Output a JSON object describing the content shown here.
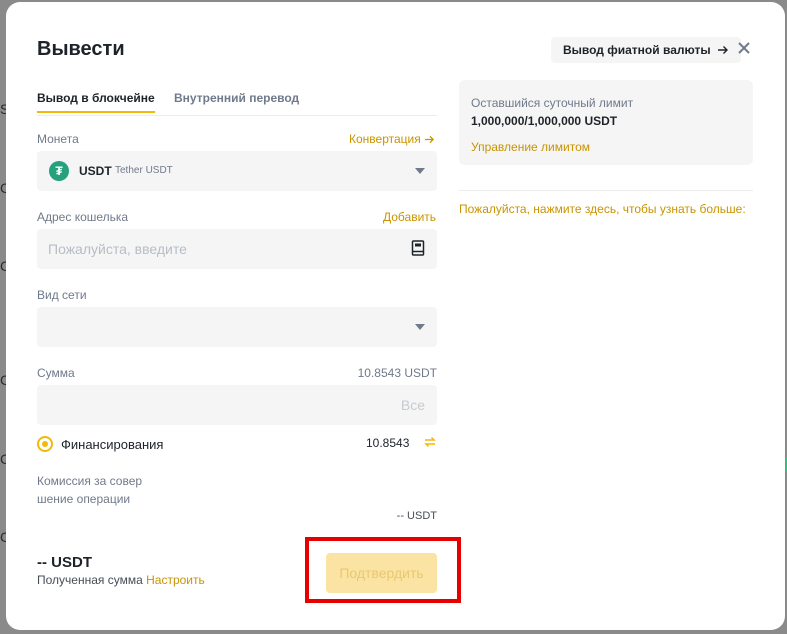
{
  "modal": {
    "title": "Вывести",
    "fiat_button": "Вывод фиатной валюты"
  },
  "tabs": [
    {
      "label": "Вывод в блокчейне",
      "active": true
    },
    {
      "label": "Внутренний перевод",
      "active": false
    }
  ],
  "coin": {
    "label": "Монета",
    "convert_link": "Конвертация",
    "symbol": "USDT",
    "name": "Tether USDT",
    "icon_glyph": "₮",
    "icon_color": "#26a17b"
  },
  "address": {
    "label": "Адрес кошелька",
    "add_link": "Добавить",
    "placeholder": "Пожалуйста, введите"
  },
  "network": {
    "label": "Вид сети"
  },
  "amount": {
    "label": "Сумма",
    "available": "10.8543 USDT",
    "all_label": "Все"
  },
  "funding": {
    "label": "Финансирования",
    "value": "10.8543"
  },
  "fee": {
    "label": "Комиссия за совершение операции",
    "value": "-- USDT"
  },
  "receive": {
    "amount": "-- USDT",
    "label": "Полученная сумма",
    "adjust_link": "Настроить"
  },
  "confirm_button": "Подтвердить",
  "limit": {
    "title": "Оставшийся суточный лимит",
    "value": "1,000,000/1,000,000 USDT",
    "manage_link": "Управление лимитом"
  },
  "learn_more": "Пожалуйста, нажмите здесь, чтобы узнать больше:",
  "background_glyphs": [
    "S",
    "C",
    "C",
    "C",
    "C",
    "C"
  ],
  "colors": {
    "accent": "#f0b90b",
    "link": "#c99400",
    "highlight": "#e60000"
  }
}
